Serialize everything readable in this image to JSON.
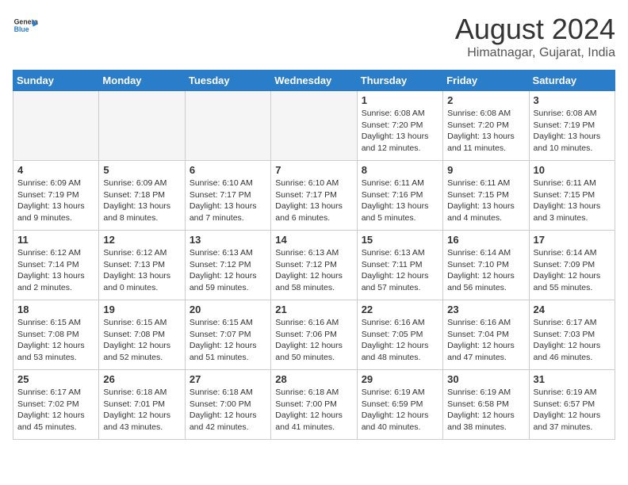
{
  "logo": {
    "line1": "General",
    "line2": "Blue"
  },
  "title": "August 2024",
  "location": "Himatnagar, Gujarat, India",
  "days_of_week": [
    "Sunday",
    "Monday",
    "Tuesday",
    "Wednesday",
    "Thursday",
    "Friday",
    "Saturday"
  ],
  "weeks": [
    [
      {
        "day": "",
        "empty": true
      },
      {
        "day": "",
        "empty": true
      },
      {
        "day": "",
        "empty": true
      },
      {
        "day": "",
        "empty": true
      },
      {
        "day": "1",
        "sunrise": "6:08 AM",
        "sunset": "7:20 PM",
        "daylight": "13 hours and 12 minutes."
      },
      {
        "day": "2",
        "sunrise": "6:08 AM",
        "sunset": "7:20 PM",
        "daylight": "13 hours and 11 minutes."
      },
      {
        "day": "3",
        "sunrise": "6:08 AM",
        "sunset": "7:19 PM",
        "daylight": "13 hours and 10 minutes."
      }
    ],
    [
      {
        "day": "4",
        "sunrise": "6:09 AM",
        "sunset": "7:19 PM",
        "daylight": "13 hours and 9 minutes."
      },
      {
        "day": "5",
        "sunrise": "6:09 AM",
        "sunset": "7:18 PM",
        "daylight": "13 hours and 8 minutes."
      },
      {
        "day": "6",
        "sunrise": "6:10 AM",
        "sunset": "7:17 PM",
        "daylight": "13 hours and 7 minutes."
      },
      {
        "day": "7",
        "sunrise": "6:10 AM",
        "sunset": "7:17 PM",
        "daylight": "13 hours and 6 minutes."
      },
      {
        "day": "8",
        "sunrise": "6:11 AM",
        "sunset": "7:16 PM",
        "daylight": "13 hours and 5 minutes."
      },
      {
        "day": "9",
        "sunrise": "6:11 AM",
        "sunset": "7:15 PM",
        "daylight": "13 hours and 4 minutes."
      },
      {
        "day": "10",
        "sunrise": "6:11 AM",
        "sunset": "7:15 PM",
        "daylight": "13 hours and 3 minutes."
      }
    ],
    [
      {
        "day": "11",
        "sunrise": "6:12 AM",
        "sunset": "7:14 PM",
        "daylight": "13 hours and 2 minutes."
      },
      {
        "day": "12",
        "sunrise": "6:12 AM",
        "sunset": "7:13 PM",
        "daylight": "13 hours and 0 minutes."
      },
      {
        "day": "13",
        "sunrise": "6:13 AM",
        "sunset": "7:12 PM",
        "daylight": "12 hours and 59 minutes."
      },
      {
        "day": "14",
        "sunrise": "6:13 AM",
        "sunset": "7:12 PM",
        "daylight": "12 hours and 58 minutes."
      },
      {
        "day": "15",
        "sunrise": "6:13 AM",
        "sunset": "7:11 PM",
        "daylight": "12 hours and 57 minutes."
      },
      {
        "day": "16",
        "sunrise": "6:14 AM",
        "sunset": "7:10 PM",
        "daylight": "12 hours and 56 minutes."
      },
      {
        "day": "17",
        "sunrise": "6:14 AM",
        "sunset": "7:09 PM",
        "daylight": "12 hours and 55 minutes."
      }
    ],
    [
      {
        "day": "18",
        "sunrise": "6:15 AM",
        "sunset": "7:08 PM",
        "daylight": "12 hours and 53 minutes."
      },
      {
        "day": "19",
        "sunrise": "6:15 AM",
        "sunset": "7:08 PM",
        "daylight": "12 hours and 52 minutes."
      },
      {
        "day": "20",
        "sunrise": "6:15 AM",
        "sunset": "7:07 PM",
        "daylight": "12 hours and 51 minutes."
      },
      {
        "day": "21",
        "sunrise": "6:16 AM",
        "sunset": "7:06 PM",
        "daylight": "12 hours and 50 minutes."
      },
      {
        "day": "22",
        "sunrise": "6:16 AM",
        "sunset": "7:05 PM",
        "daylight": "12 hours and 48 minutes."
      },
      {
        "day": "23",
        "sunrise": "6:16 AM",
        "sunset": "7:04 PM",
        "daylight": "12 hours and 47 minutes."
      },
      {
        "day": "24",
        "sunrise": "6:17 AM",
        "sunset": "7:03 PM",
        "daylight": "12 hours and 46 minutes."
      }
    ],
    [
      {
        "day": "25",
        "sunrise": "6:17 AM",
        "sunset": "7:02 PM",
        "daylight": "12 hours and 45 minutes."
      },
      {
        "day": "26",
        "sunrise": "6:18 AM",
        "sunset": "7:01 PM",
        "daylight": "12 hours and 43 minutes."
      },
      {
        "day": "27",
        "sunrise": "6:18 AM",
        "sunset": "7:00 PM",
        "daylight": "12 hours and 42 minutes."
      },
      {
        "day": "28",
        "sunrise": "6:18 AM",
        "sunset": "7:00 PM",
        "daylight": "12 hours and 41 minutes."
      },
      {
        "day": "29",
        "sunrise": "6:19 AM",
        "sunset": "6:59 PM",
        "daylight": "12 hours and 40 minutes."
      },
      {
        "day": "30",
        "sunrise": "6:19 AM",
        "sunset": "6:58 PM",
        "daylight": "12 hours and 38 minutes."
      },
      {
        "day": "31",
        "sunrise": "6:19 AM",
        "sunset": "6:57 PM",
        "daylight": "12 hours and 37 minutes."
      }
    ]
  ],
  "daylight_label": "Daylight:",
  "sunrise_label": "Sunrise:",
  "sunset_label": "Sunset:"
}
